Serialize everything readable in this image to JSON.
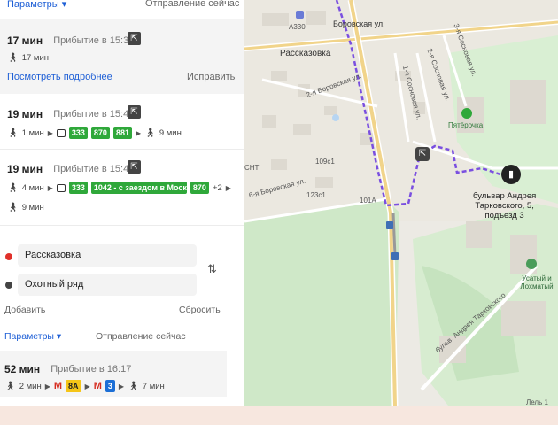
{
  "top_header": {
    "params_label": "Параметры ▾",
    "departure": "Отправление сейчас"
  },
  "routes": [
    {
      "duration": "17 мин",
      "arrival": "Прибытие в 15:38",
      "legs_walk": "17 мин"
    },
    {
      "duration": "19 мин",
      "arrival": "Прибытие в 15:40",
      "walk_start": "1 мин",
      "buses": [
        "333",
        "870",
        "881"
      ],
      "walk_end": "9 мин"
    },
    {
      "duration": "19 мин",
      "arrival": "Прибытие в 15:40",
      "walk_start": "4 мин",
      "buses": [
        "333",
        "1042 - с заездом в Моск...",
        "870"
      ],
      "more": "+2",
      "walk_end": "9 мин"
    }
  ],
  "route_actions": {
    "details": "Посмотреть подробнее",
    "fix": "Исправить"
  },
  "form": {
    "from": "Рассказовка",
    "to": "Охотный ряд",
    "add": "Добавить",
    "reset": "Сбросить"
  },
  "form_header": {
    "params_label": "Параметры ▾",
    "departure": "Отправление сейчас"
  },
  "metro_route": {
    "duration": "52 мин",
    "arrival": "Прибытие в 16:17",
    "walk_start": "2 мин",
    "line1": "8А",
    "line2": "3",
    "walk_end": "7 мин"
  },
  "map": {
    "labels": {
      "borovskaya": "Боровская ул.",
      "a330": "А330",
      "rasskazovka": "Рассказовка",
      "borovskaya2": "2-я Боровская ул.",
      "sosnovaya1": "1-я Сосновая ул.",
      "sosnovaya2": "2-я Сосновая ул.",
      "sosnovaya3": "3-я Сосновая ул.",
      "borovskaya6": "6-я Боровская ул.",
      "snt": "СНТ",
      "pyaterochka": "Пятёрочка",
      "usatyi": "Усатый и Лохматый",
      "tarkovsky_blvd": "бульв. Андрея Тарковского",
      "lel": "Лель 1",
      "b101": "101А",
      "b109": "109с1",
      "b123": "123с1"
    },
    "destination": [
      "бульвар Андрея",
      "Тарковского, 5,",
      "подъезд 3"
    ]
  },
  "colors": {
    "link": "#1e5fd6",
    "bus_green": "#2fa83a",
    "metro_yellow": "#f5c518",
    "metro_blue": "#1c6fd6",
    "route_purple": "#7a4fe0"
  }
}
